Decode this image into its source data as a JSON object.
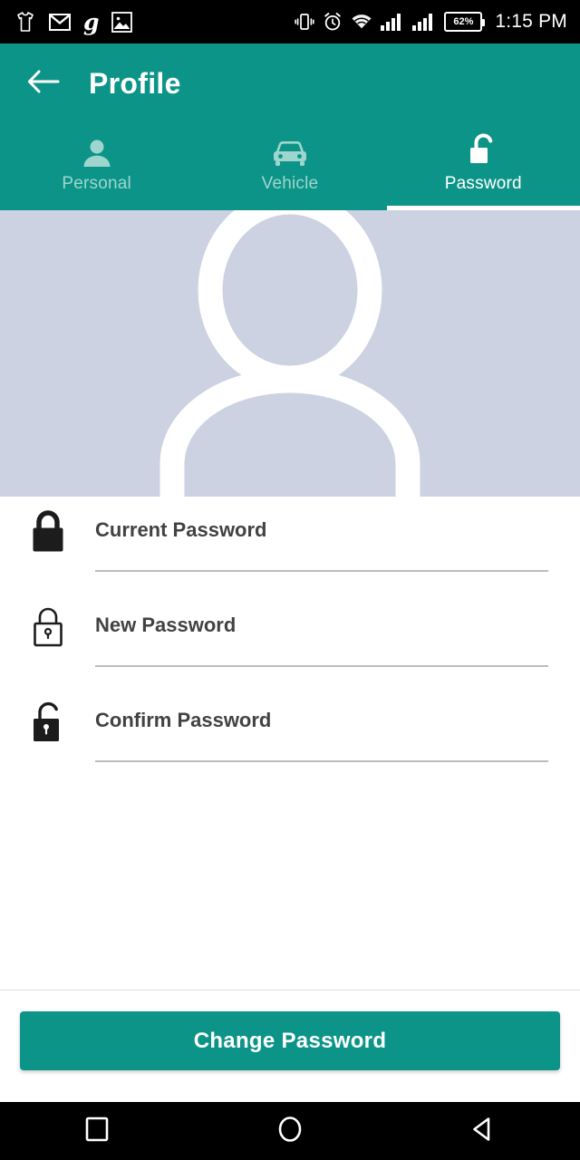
{
  "statusbar": {
    "left_icons": [
      "tshirt-icon",
      "gmail-icon",
      "g-app-icon",
      "photos-icon"
    ],
    "g_label": "g",
    "right_icons": [
      "vibrate-icon",
      "alarm-icon",
      "wifi-icon",
      "signal-sim1-icon",
      "signal-sim2-icon"
    ],
    "battery_percent": "62%",
    "time": "1:15 PM"
  },
  "appbar": {
    "back_icon": "arrow-left-icon",
    "title": "Profile",
    "background_color": "#0d9488"
  },
  "tabs": [
    {
      "label": "Personal",
      "icon": "person-icon",
      "active": false
    },
    {
      "label": "Vehicle",
      "icon": "car-icon",
      "active": false
    },
    {
      "label": "Password",
      "icon": "unlock-icon",
      "active": true
    }
  ],
  "avatar": {
    "icon": "person-placeholder-icon",
    "background_color": "#ccd2e2",
    "foreground_color": "#ffffff"
  },
  "form": {
    "fields": [
      {
        "label": "Current Password",
        "value": "",
        "placeholder": "Current Password",
        "icon": "lock-closed-filled-icon"
      },
      {
        "label": "New Password",
        "value": "",
        "placeholder": "New Password",
        "icon": "lock-closed-outline-icon"
      },
      {
        "label": "Confirm Password",
        "value": "",
        "placeholder": "Confirm Password",
        "icon": "lock-open-filled-icon"
      }
    ]
  },
  "bottom": {
    "submit_label": "Change Password",
    "submit_color": "#0d9488"
  },
  "navbar": {
    "recents_icon": "square-icon",
    "home_icon": "circle-icon",
    "back_icon": "triangle-back-icon"
  }
}
